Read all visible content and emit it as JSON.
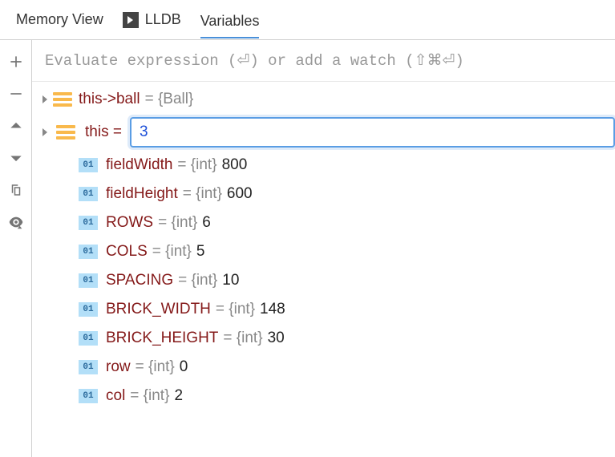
{
  "tabs": {
    "memory_view": "Memory View",
    "lldb": "LLDB",
    "variables": "Variables"
  },
  "eval_hint": "Evaluate expression (⏎) or add a watch (⇧⌘⏎)",
  "int_badge": "01",
  "rows": {
    "this_ball": {
      "name": "this->ball",
      "type": "= {Ball}"
    },
    "this": {
      "name": "this =",
      "input_value": "3"
    },
    "fieldWidth": {
      "name": "fieldWidth",
      "type": "= {int}",
      "value": "800"
    },
    "fieldHeight": {
      "name": "fieldHeight",
      "type": "= {int}",
      "value": "600"
    },
    "rows_const": {
      "name": "ROWS",
      "type": "= {int}",
      "value": "6"
    },
    "cols_const": {
      "name": "COLS",
      "type": "= {int}",
      "value": "5"
    },
    "spacing": {
      "name": "SPACING",
      "type": "= {int}",
      "value": "10"
    },
    "brick_width": {
      "name": "BRICK_WIDTH",
      "type": "= {int}",
      "value": "148"
    },
    "brick_height": {
      "name": "BRICK_HEIGHT",
      "type": "= {int}",
      "value": "30"
    },
    "row_var": {
      "name": "row",
      "type": "= {int}",
      "value": "0"
    },
    "col_var": {
      "name": "col",
      "type": "= {int}",
      "value": "2"
    }
  }
}
